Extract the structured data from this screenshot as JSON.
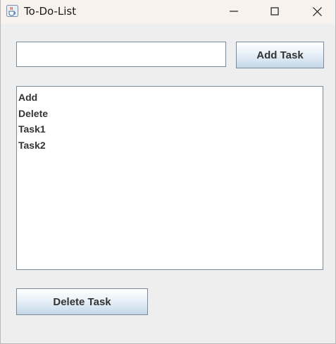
{
  "window": {
    "title": "To-Do-List",
    "icon": "java-cup-icon"
  },
  "titlebar_controls": [
    "minimize-icon",
    "maximize-icon",
    "close-icon"
  ],
  "input": {
    "value": "",
    "placeholder": ""
  },
  "buttons": {
    "add_label": "Add Task",
    "delete_label": "Delete Task"
  },
  "tasks": [
    "Add",
    "Delete",
    "Task1",
    "Task2"
  ],
  "colors": {
    "background": "#eeeeee",
    "titlebar": "#f8f2ee",
    "border": "#7a8a9a",
    "button_gradient_bottom": "#c4d6e8"
  }
}
